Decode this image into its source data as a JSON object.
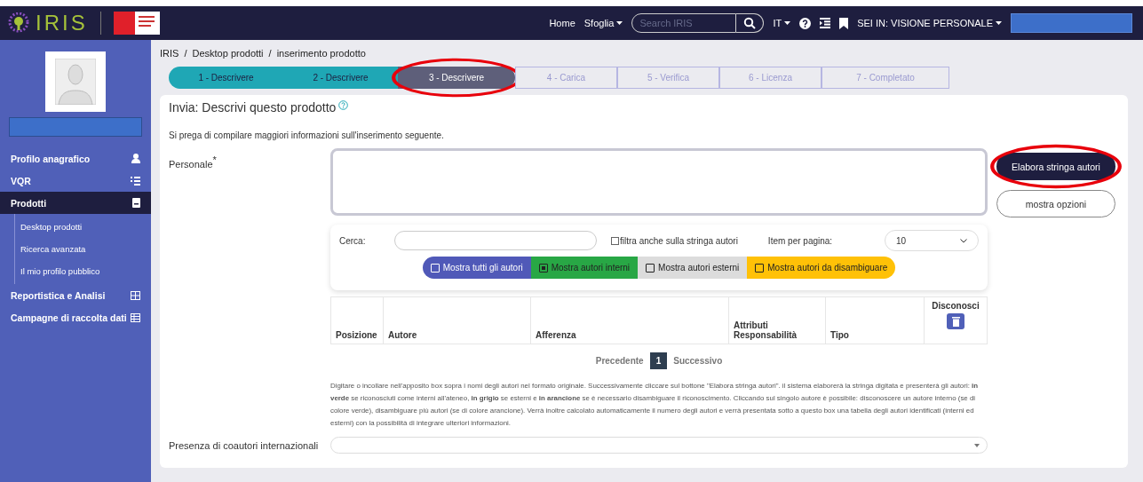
{
  "topbar": {
    "logo": "IRIS",
    "nav": [
      {
        "label": "Home",
        "dropdown": false
      },
      {
        "label": "Sfoglia",
        "dropdown": true
      }
    ],
    "search": {
      "placeholder": "Search IRIS"
    },
    "language": "IT",
    "view": "SEI IN: VISIONE PERSONALE"
  },
  "sidebar": {
    "items": [
      {
        "label": "Profilo anagrafico",
        "selected": false
      },
      {
        "label": "VQR",
        "selected": false
      },
      {
        "label": "Prodotti",
        "selected": true,
        "children": [
          {
            "label": "Desktop prodotti"
          },
          {
            "label": "Ricerca avanzata"
          },
          {
            "label": "Il mio profilo pubblico"
          }
        ]
      },
      {
        "label": "Reportistica e Analisi",
        "selected": false
      },
      {
        "label": "Campagne di raccolta dati",
        "selected": false
      }
    ]
  },
  "breadcrumb": [
    {
      "label": "IRIS"
    },
    {
      "separator": "/",
      "label": "Desktop prodotti"
    },
    {
      "separator": "/",
      "label": "inserimento prodotto"
    }
  ],
  "steps": [
    {
      "label": "1 - Descrivere",
      "completed": true,
      "selected": false
    },
    {
      "label": "2 - Descrivere",
      "completed": true,
      "selected": false
    },
    {
      "label": "3 - Descrivere",
      "completed": false,
      "selected": true
    },
    {
      "label": "4 - Carica",
      "completed": false,
      "selected": false
    },
    {
      "label": "5 - Verifica",
      "completed": false,
      "selected": false
    },
    {
      "label": "6 - Licenza",
      "completed": false,
      "selected": false
    },
    {
      "label": "7 - Completato",
      "completed": false,
      "selected": false
    }
  ],
  "form": {
    "title": "Invia: Descrivi questo prodotto",
    "intro": "Si prega di compilare maggiori informazioni sull'inserimento seguente.",
    "field_label": "Personale",
    "required_mark": "*",
    "buttons": [
      {
        "label": "Elabora stringa autori",
        "kind": "primary"
      },
      {
        "label": "mostra opzioni",
        "kind": "outline"
      }
    ],
    "search_label": "Cerca:",
    "filter_checkbox": {
      "label": "filtra anche sulla stringa autori",
      "checked": false
    },
    "per_page_label": "Item per pagina:",
    "per_page_value": "10",
    "chips": [
      {
        "label": "Mostra tutti gli autori",
        "checked": false,
        "color": "#5059b8"
      },
      {
        "label": "Mostra autori interni",
        "checked": true,
        "color": "#28a745"
      },
      {
        "label": "Mostra autori esterni",
        "checked": false,
        "color": "#dcdcdc"
      },
      {
        "label": "Mostra autori da disambiguare",
        "checked": false,
        "color": "#ffc107"
      }
    ],
    "table": {
      "columns": [
        "Posizione",
        "Autore",
        "Afferenza",
        "Attributi Responsabilità",
        "Tipo",
        "Disconosci"
      ]
    },
    "pagination": {
      "previous": "Precedente",
      "pages": [
        {
          "label": "1",
          "selected": true
        }
      ],
      "next": "Successivo"
    },
    "help": "Digitare o incollare nell'apposito box sopra i nomi degli autori nel formato originale. Successivamente cliccare sul bottone \"Elabora stringa autori\". il sistema elaborerà la stringa digitata e presenterà gli autori: **in verde** se riconosciuti come interni all'ateneo, **in grigio** se esterni e **in arancione** se è necessario disambiguare il riconoscimento. Cliccando sul singolo autore è possibile: disconoscere un autore interno (se di colore verde), disambiguare più autori (se di colore arancione). Verrà inoltre calcolato automaticamente il numero degli autori e verrà presentata sotto a questo box una tabella degli autori identificati (interni ed esterni) con la possibilità di integrare ulteriori informazioni.",
    "second_field_label": "Presenza di coautori internazionali"
  }
}
